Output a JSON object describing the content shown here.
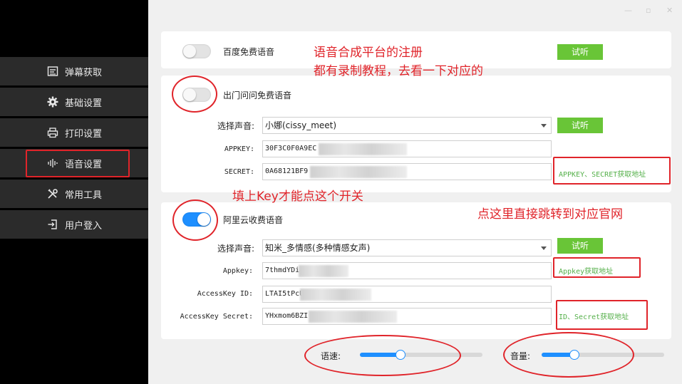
{
  "window_controls": {
    "minimize": "—",
    "maximize": "▫",
    "close": "✕"
  },
  "sidebar": {
    "items": [
      {
        "label": "弹幕获取",
        "icon": "list-icon"
      },
      {
        "label": "基础设置",
        "icon": "gear-icon"
      },
      {
        "label": "打印设置",
        "icon": "printer-icon"
      },
      {
        "label": "语音设置",
        "icon": "audio-wave-icon"
      },
      {
        "label": "常用工具",
        "icon": "tools-icon"
      },
      {
        "label": "用户登入",
        "icon": "login-icon"
      }
    ]
  },
  "baidu": {
    "title": "百度免费语音",
    "enabled": false,
    "test_label": "试听"
  },
  "chumen": {
    "title": "出门问问免费语音",
    "enabled": false,
    "voice_label": "选择声音:",
    "voice_value": "小娜(cissy_meet)",
    "test_label": "试听",
    "appkey_label": "APPKEY:",
    "appkey_value": "30F3C0F0A9EC",
    "secret_label": "SECRET:",
    "secret_value": "0A68121BF9",
    "link": "APPKEY、SECRET获取地址"
  },
  "aliyun": {
    "title": "阿里云收费语音",
    "enabled": true,
    "voice_label": "选择声音:",
    "voice_value": "知米_多情感(多种情感女声)",
    "test_label": "试听",
    "appkey_label": "Appkey:",
    "appkey_value": "7thmdYDi",
    "accesskey_id_label": "AccessKey ID:",
    "accesskey_id_value": "LTAI5tPcU",
    "accesskey_secret_label": "AccessKey Secret:",
    "accesskey_secret_value": "YHxmom6BZI",
    "appkey_link": "Appkey获取地址",
    "secret_link": "ID、Secret获取地址"
  },
  "sliders": {
    "speed_label": "语速:",
    "speed_level": 0.33,
    "volume_label": "音量:",
    "volume_level": 0.27
  },
  "annotations": {
    "line1": "语音合成平台的注册",
    "line2": "都有录制教程，去看一下对应的",
    "key_hint": "填上Key才能点这个开关",
    "link_hint": "点这里直接跳转到对应官网"
  },
  "colors": {
    "accent_blue": "#1e8fff",
    "button_green": "#69c537",
    "link_green": "#55b04a",
    "annotation_red": "#e0242a",
    "sidebar_bg": "#000000",
    "nav_bg": "#2b2b2b"
  }
}
